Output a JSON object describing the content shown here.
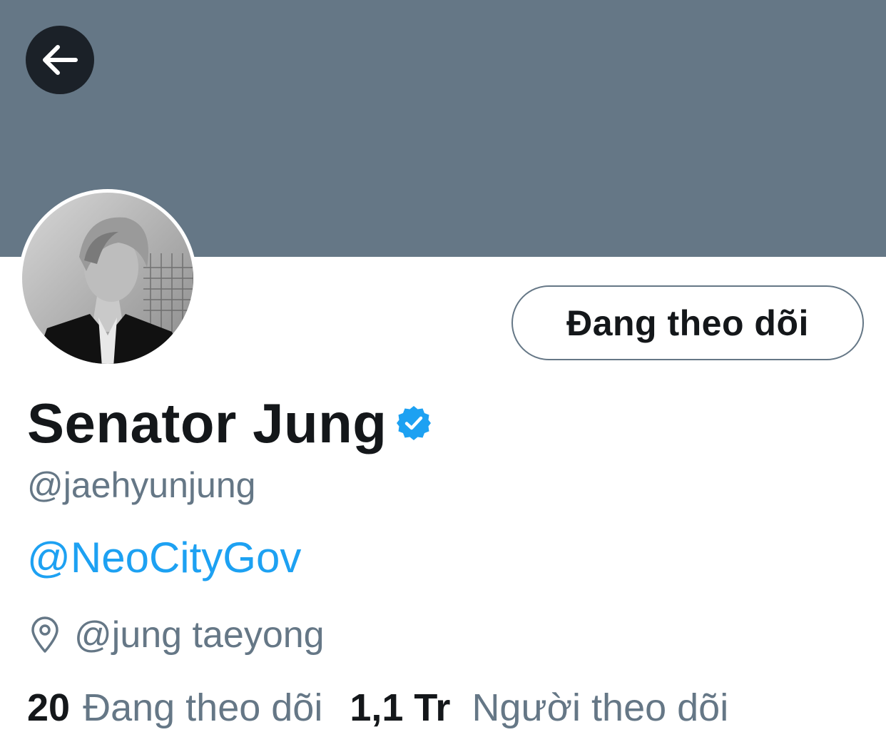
{
  "colors": {
    "banner": "#657786",
    "back_button_bg": "#1b2128",
    "text_primary": "#14171a",
    "text_secondary": "#657786",
    "link": "#1da1f2",
    "verified": "#1da1f2",
    "button_border": "#657786"
  },
  "header": {
    "back_icon": "arrow-left-icon"
  },
  "profile": {
    "avatar": "profile-photo",
    "follow_button_label": "Đang theo dõi",
    "display_name": "Senator Jung",
    "verified_icon": "verified-badge-icon",
    "handle": "@jaehyunjung",
    "bio_link": "@NeoCityGov",
    "location_icon": "location-pin-icon",
    "location": "@jung taeyong"
  },
  "stats": {
    "following_count": "20",
    "following_label": "Đang theo dõi",
    "followers_count": "1,1 Tr",
    "followers_label": "Người theo dõi"
  }
}
